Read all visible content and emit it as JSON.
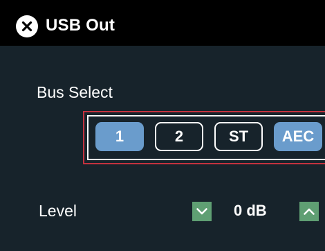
{
  "header": {
    "title": "USB Out",
    "close_icon": "close-circle-icon"
  },
  "bus_select": {
    "label": "Bus Select",
    "buttons": [
      {
        "label": "1",
        "selected": true
      },
      {
        "label": "2",
        "selected": false
      },
      {
        "label": "ST",
        "selected": false
      },
      {
        "label": "AEC",
        "selected": true
      }
    ]
  },
  "level": {
    "label": "Level",
    "value": "0 dB",
    "down_icon": "chevron-down-icon",
    "up_icon": "chevron-up-icon"
  },
  "colors": {
    "background": "#17232b",
    "header": "#000000",
    "selected_button": "#6a9ccc",
    "stepper_button": "#5f9f73",
    "highlight_frame": "#c4323f"
  }
}
